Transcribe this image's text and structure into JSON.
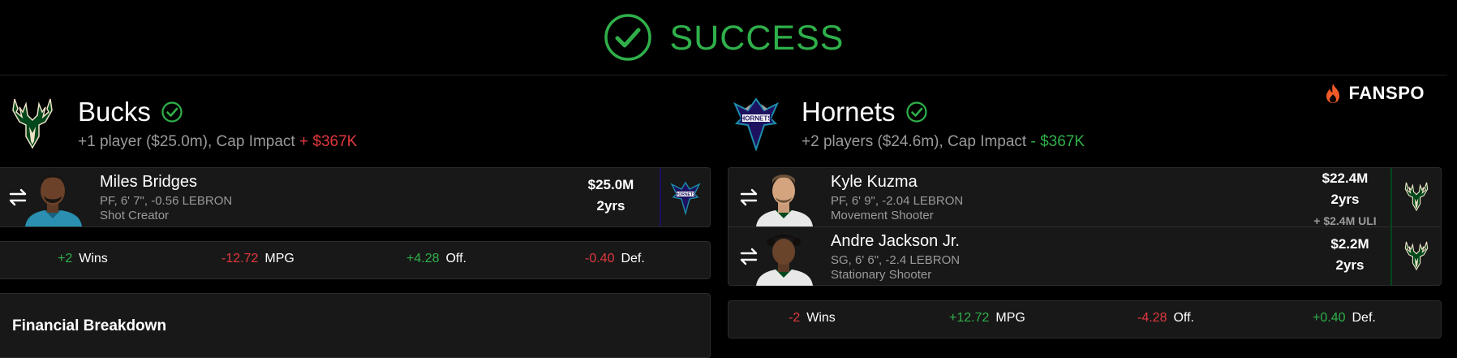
{
  "header": {
    "status_text": "SUCCESS"
  },
  "brand": {
    "name": "FANSPO"
  },
  "teams": [
    {
      "name": "Bucks",
      "summary_prefix": "+1 player ($25.0m), Cap Impact ",
      "cap_impact": "+ $367K",
      "players": [
        {
          "name": "Miles Bridges",
          "position_line": "PF, 6' 7\", -0.56 LEBRON",
          "role": "Shot Creator",
          "salary": "$25.0M",
          "years": "2yrs",
          "destination": "Hornets"
        }
      ],
      "stats": [
        {
          "value": "+2",
          "label": "Wins",
          "tone": "pos"
        },
        {
          "value": "-12.72",
          "label": "MPG",
          "tone": "neg"
        },
        {
          "value": "+4.28",
          "label": "Off.",
          "tone": "pos"
        },
        {
          "value": "-0.40",
          "label": "Def.",
          "tone": "neg"
        }
      ]
    },
    {
      "name": "Hornets",
      "summary_prefix": "+2 players ($24.6m), Cap Impact ",
      "cap_impact": "- $367K",
      "players": [
        {
          "name": "Kyle Kuzma",
          "position_line": "PF, 6' 9\", -2.04 LEBRON",
          "role": "Movement Shooter",
          "salary": "$22.4M",
          "years": "2yrs",
          "extra": "+ $2.4M ULI",
          "destination": "Bucks"
        },
        {
          "name": "Andre Jackson Jr.",
          "position_line": "SG, 6' 6\", -2.4 LEBRON",
          "role": "Stationary Shooter",
          "salary": "$2.2M",
          "years": "2yrs",
          "destination": "Bucks"
        }
      ],
      "stats": [
        {
          "value": "-2",
          "label": "Wins",
          "tone": "neg"
        },
        {
          "value": "+12.72",
          "label": "MPG",
          "tone": "pos"
        },
        {
          "value": "-4.28",
          "label": "Off.",
          "tone": "neg"
        },
        {
          "value": "+0.40",
          "label": "Def.",
          "tone": "pos"
        }
      ]
    }
  ],
  "financial": {
    "title": "Financial Breakdown"
  },
  "colors": {
    "success": "#2fb04a",
    "negative": "#e0393e",
    "bucks_green": "#00471b",
    "hornets_teal": "#1d8cab",
    "hornets_purple": "#1d1160",
    "brand_orange": "#f05a28"
  },
  "icons": [
    "check-circle-icon",
    "flame-icon",
    "check-icon",
    "swap-arrows-icon",
    "bucks-logo",
    "hornets-logo"
  ]
}
